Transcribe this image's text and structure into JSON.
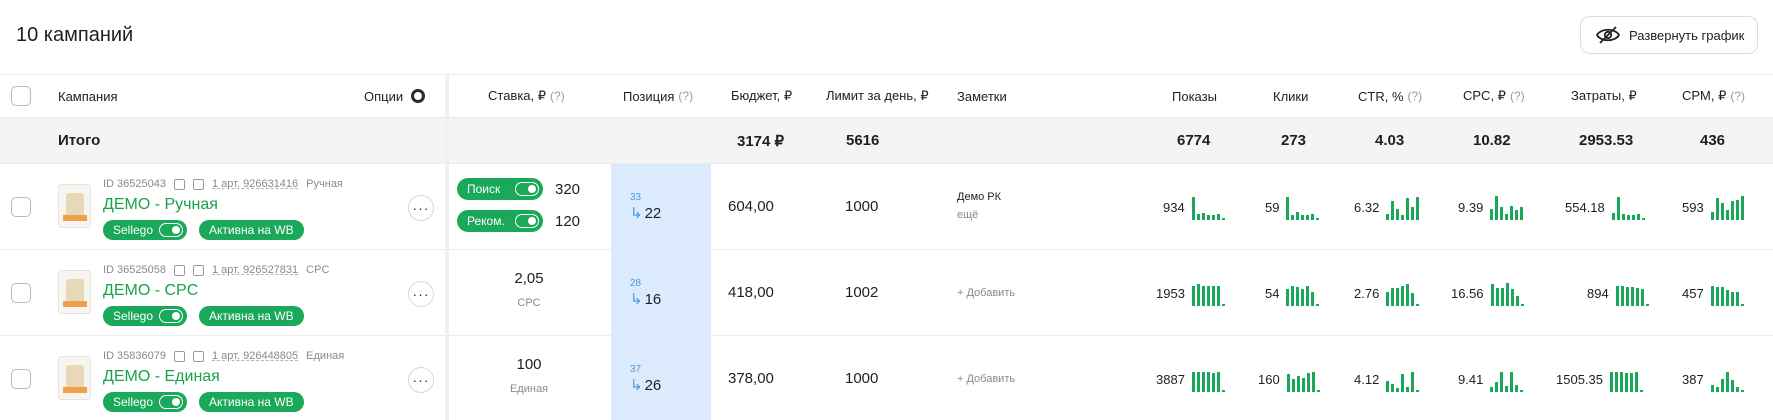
{
  "page": {
    "title": "10 кампаний",
    "expand_button": "Развернуть график"
  },
  "headers": {
    "campaign": "Кампания",
    "options": "Опции",
    "bid": "Ставка, ₽",
    "position": "Позиция",
    "budget": "Бюджет, ₽",
    "day_limit": "Лимит за день, ₽",
    "notes": "Заметки",
    "impressions": "Показы",
    "clicks": "Клики",
    "ctr": "CTR, %",
    "cpc": "CPC, ₽",
    "spend": "Затраты, ₽",
    "cpm": "CPM, ₽",
    "help": "(?)"
  },
  "totals": {
    "label": "Итого",
    "budget": "3174 ₽",
    "day_limit": "5616",
    "impressions": "6774",
    "clicks": "273",
    "ctr": "4.03",
    "cpc": "10.82",
    "spend": "2953.53",
    "cpm": "436"
  },
  "rows": [
    {
      "id": "ID 36525043",
      "articles": "1 арт. 926631416",
      "type": "Ручная",
      "name": "ДЕМО - Ручная",
      "badge_sellego": "Sellego",
      "badge_status": "Активна на WB",
      "bid_search_label": "Поиск",
      "bid_search": "320",
      "bid_rec_label": "Реком.",
      "bid_rec": "120",
      "pos_old": "33",
      "pos_new": "22",
      "budget": "604,00",
      "day_limit": "1000",
      "note": "Демо РК",
      "note_sub": "ещё",
      "impressions": "934",
      "clicks": "59",
      "ctr": "6.32",
      "cpc": "9.39",
      "spend": "554.18",
      "cpm": "593",
      "spark_impressions": [
        0.95,
        0.25,
        0.3,
        0.2,
        0.2,
        0.25,
        0.1
      ],
      "spark_clicks": [
        0.95,
        0.2,
        0.35,
        0.2,
        0.2,
        0.25,
        0.1
      ],
      "spark_ctr": [
        0.25,
        0.8,
        0.45,
        0.2,
        0.9,
        0.55,
        0.95
      ],
      "spark_cpc": [
        0.45,
        1.0,
        0.55,
        0.25,
        0.6,
        0.4,
        0.55
      ],
      "spark_spend": [
        0.3,
        0.95,
        0.25,
        0.2,
        0.2,
        0.25,
        0.1
      ],
      "spark_cpm": [
        0.35,
        0.9,
        0.7,
        0.4,
        0.8,
        0.85,
        1.0
      ]
    },
    {
      "id": "ID 36525058",
      "articles": "1 арт. 926527831",
      "type": "CPC",
      "name": "ДЕМО - CPC",
      "badge_sellego": "Sellego",
      "badge_status": "Активна на WB",
      "bid_value": "2,05",
      "bid_type": "CPC",
      "pos_old": "28",
      "pos_new": "16",
      "budget": "418,00",
      "day_limit": "1002",
      "note": "+ Добавить",
      "impressions": "1953",
      "clicks": "54",
      "ctr": "2.76",
      "cpc": "16.56",
      "spend": "894",
      "cpm": "457",
      "spark_impressions": [
        0.85,
        0.9,
        0.85,
        0.85,
        0.85,
        0.85,
        0.1
      ],
      "spark_clicks": [
        0.7,
        0.85,
        0.8,
        0.7,
        0.85,
        0.6,
        0.1
      ],
      "spark_ctr": [
        0.6,
        0.75,
        0.75,
        0.85,
        0.9,
        0.55,
        0.1
      ],
      "spark_cpc": [
        0.9,
        0.75,
        0.75,
        0.95,
        0.7,
        0.4,
        0.1
      ],
      "spark_spend": [
        0.85,
        0.85,
        0.8,
        0.8,
        0.75,
        0.7,
        0.1
      ],
      "spark_cpm": [
        0.85,
        0.8,
        0.8,
        0.65,
        0.6,
        0.6,
        0.1
      ]
    },
    {
      "id": "ID 35836079",
      "articles": "1 арт. 926448805",
      "type": "Единая",
      "name": "ДЕМО - Единая",
      "badge_sellego": "Sellego",
      "badge_status": "Активна на WB",
      "bid_value": "100",
      "bid_type": "Единая",
      "pos_old": "37",
      "pos_new": "26",
      "budget": "378,00",
      "day_limit": "1000",
      "note": "+ Добавить",
      "impressions": "3887",
      "clicks": "160",
      "ctr": "4.12",
      "cpc": "9.41",
      "spend": "1505.35",
      "cpm": "387",
      "spark_impressions": [
        0.85,
        0.85,
        0.85,
        0.85,
        0.8,
        0.85,
        0.1
      ],
      "spark_clicks": [
        0.75,
        0.55,
        0.65,
        0.6,
        0.8,
        0.85,
        0.1
      ],
      "spark_ctr": [
        0.45,
        0.35,
        0.15,
        0.75,
        0.2,
        0.85,
        0.1
      ],
      "spark_cpc": [
        0.2,
        0.4,
        0.85,
        0.25,
        0.85,
        0.3,
        0.1
      ],
      "spark_spend": [
        0.85,
        0.85,
        0.85,
        0.8,
        0.8,
        0.85,
        0.1
      ],
      "spark_cpm": [
        0.3,
        0.2,
        0.55,
        0.85,
        0.5,
        0.2,
        0.1
      ]
    }
  ],
  "colors": {
    "accent": "#1aa85a",
    "position_bg": "#dceafd",
    "link": "#16a34a"
  }
}
